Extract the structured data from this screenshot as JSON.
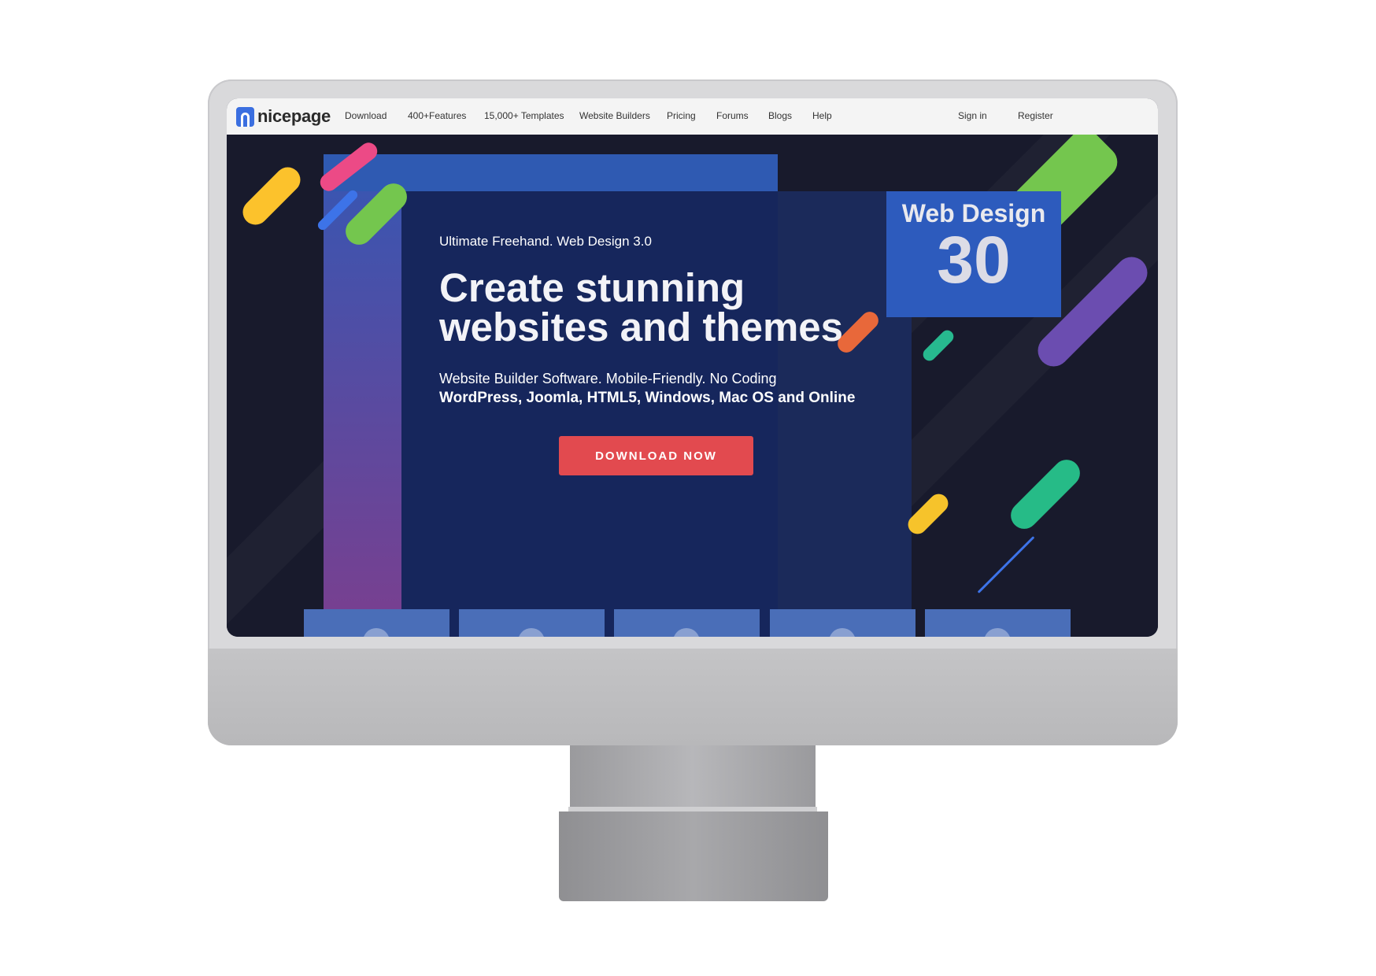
{
  "nav": {
    "brand": "nicepage",
    "items": [
      "Download",
      "400+Features",
      "15,000+ Templates",
      "Website Builders",
      "Pricing",
      "Forums",
      "Blogs",
      "Help"
    ],
    "signin": "Sign in",
    "register": "Register"
  },
  "hero": {
    "eyebrow": "Ultimate Freehand. Web Design 3.0",
    "headline_line1": "Create stunning",
    "headline_line2": "websites and themes",
    "sub1": "Website Builder Software. Mobile-Friendly. No Coding",
    "sub2": "WordPress, Joomla, HTML5, Windows, Mac OS and Online",
    "cta": "DOWNLOAD NOW",
    "badge_title": "Web Design",
    "badge_number": "30"
  },
  "platform_tiles": [
    "windows-icon",
    "apple-icon",
    "wordpress-icon",
    "joomla-icon",
    "globe-icon"
  ],
  "colors": {
    "brand_blue": "#3b6fe0",
    "cta_red": "#e24a4f",
    "hero_navy": "#16265c"
  }
}
